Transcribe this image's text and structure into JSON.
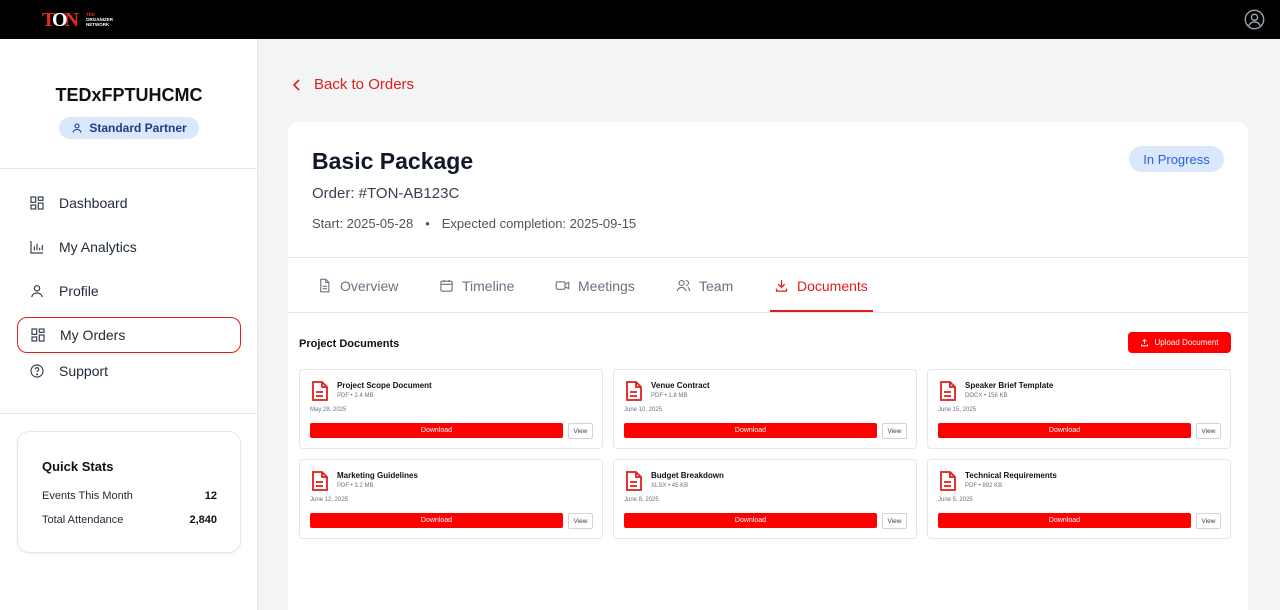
{
  "brand": {
    "mark": "TON",
    "line1": "TED",
    "line2": "ORGANIZER",
    "line3": "NETWORK"
  },
  "sidebar": {
    "org_name": "TEDxFPTUHCMC",
    "badge": "Standard Partner",
    "items": [
      {
        "label": "Dashboard",
        "icon": "dashboard-icon"
      },
      {
        "label": "My Analytics",
        "icon": "bar-chart-icon"
      },
      {
        "label": "Profile",
        "icon": "user-icon"
      },
      {
        "label": "My Orders",
        "icon": "orders-icon",
        "active": true
      },
      {
        "label": "Support",
        "icon": "help-circle-icon"
      }
    ],
    "quick_stats": {
      "title": "Quick Stats",
      "rows": [
        {
          "label": "Events This Month",
          "value": "12"
        },
        {
          "label": "Total Attendance",
          "value": "2,840"
        }
      ]
    }
  },
  "main": {
    "back_label": "Back to Orders",
    "package_title": "Basic Package",
    "order_id": "Order: #TON-AB123C",
    "start": "Start: 2025-05-28",
    "separator": "•",
    "expected": "Expected completion: 2025-09-15",
    "status": "In Progress",
    "tabs": [
      {
        "label": "Overview",
        "icon": "document-icon"
      },
      {
        "label": "Timeline",
        "icon": "calendar-icon"
      },
      {
        "label": "Meetings",
        "icon": "video-icon"
      },
      {
        "label": "Team",
        "icon": "users-icon"
      },
      {
        "label": "Documents",
        "icon": "download-icon",
        "active": true
      }
    ],
    "documents_title": "Project Documents",
    "upload_label": "Upload Document",
    "download_label": "Download",
    "view_label": "View",
    "documents": [
      {
        "name": "Project Scope Document",
        "meta": "PDF • 2.4 MB",
        "date": "May 28, 2025"
      },
      {
        "name": "Venue Contract",
        "meta": "PDF • 1.8 MB",
        "date": "June 10, 2025"
      },
      {
        "name": "Speaker Brief Template",
        "meta": "DOCX • 156 KB",
        "date": "June 15, 2025"
      },
      {
        "name": "Marketing Guidelines",
        "meta": "PDF • 3.2 MB",
        "date": "June 12, 2025"
      },
      {
        "name": "Budget Breakdown",
        "meta": "XLSX • 45 KB",
        "date": "June 8, 2025"
      },
      {
        "name": "Technical Requirements",
        "meta": "PDF • 892 KB",
        "date": "June 5, 2025"
      }
    ]
  },
  "colors": {
    "accent": "#e11d1d",
    "status_bg": "#dbe7fb",
    "status_fg": "#2563eb"
  }
}
